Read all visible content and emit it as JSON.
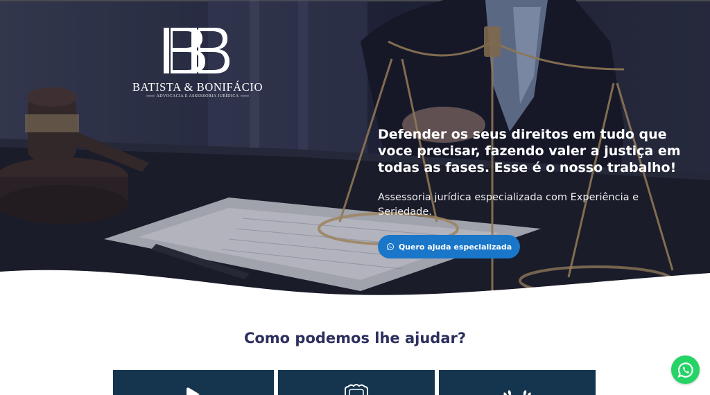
{
  "brand": {
    "monogram": "BB",
    "name": "BATISTA & BONIFÁCIO",
    "tagline": "ADVOCACIA E ASSESSORIA JURÍDICA"
  },
  "hero": {
    "heading": "Defender os seus direitos em tudo que voce precisar, fazendo valer a justiça em todas as fases. Esse é o nosso trabalho!",
    "subheading": "Assessoria jurídica especializada com Experiência e Seriedade.",
    "cta_label": "Quero ajuda especializada",
    "cta_icon": "whatsapp-icon",
    "cta_color": "#1976c9"
  },
  "services": {
    "title": "Como podemos lhe ajudar?",
    "cards": [
      {
        "icon": "play-icon"
      },
      {
        "icon": "shield-icon"
      },
      {
        "icon": "laurel-icon"
      }
    ],
    "card_color": "#15344e"
  },
  "whatsapp_float": {
    "icon": "whatsapp-icon",
    "color": "#25d366"
  },
  "colors": {
    "title": "#2c2f5e"
  }
}
